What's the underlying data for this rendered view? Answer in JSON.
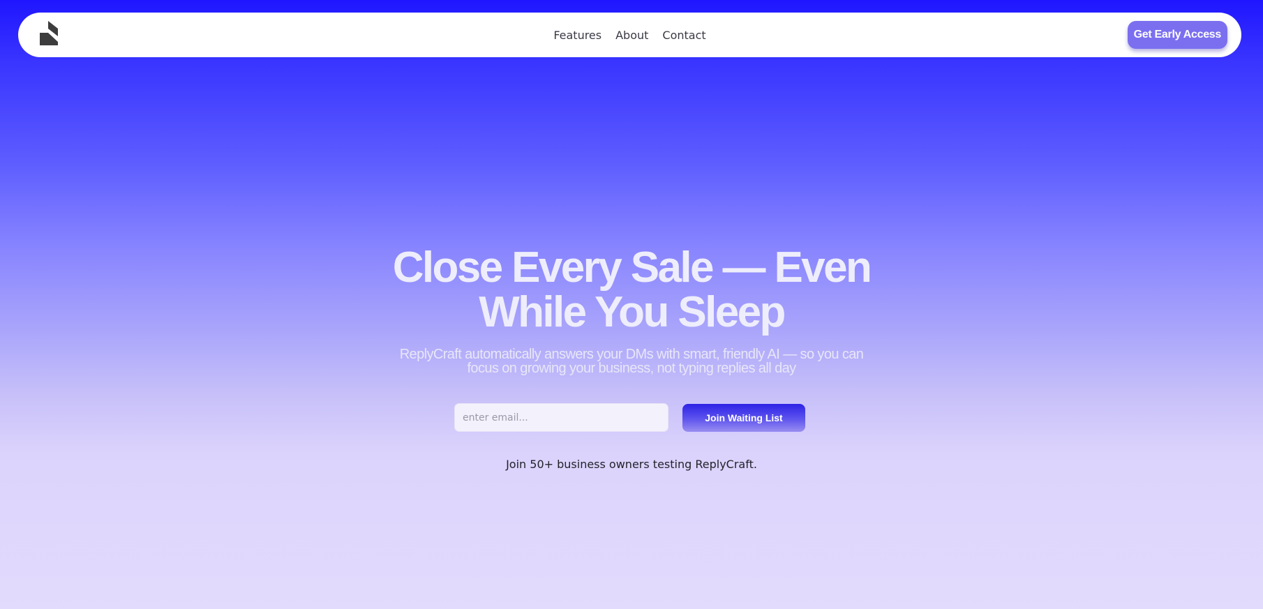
{
  "nav": {
    "logo_icon": "brand-logo-icon",
    "links": [
      {
        "label": "Features"
      },
      {
        "label": "About"
      },
      {
        "label": "Contact"
      }
    ],
    "cta_label": "Get Early Access"
  },
  "hero": {
    "title_line1": "Close Every Sale — Even",
    "title_line2": "While You Sleep",
    "subtitle": "ReplyCraft automatically answers your DMs with smart, friendly AI — so you can focus on growing your business, not typing replies all day"
  },
  "signup": {
    "email_placeholder": "enter email...",
    "email_value": "",
    "button_label": "Join Waiting List"
  },
  "social_proof": "Join 50+ business owners testing ReplyCraft.",
  "colors": {
    "accent": "#7b6ff0",
    "brand_blue": "#1f16ff",
    "join_button": "#2d22e6"
  }
}
